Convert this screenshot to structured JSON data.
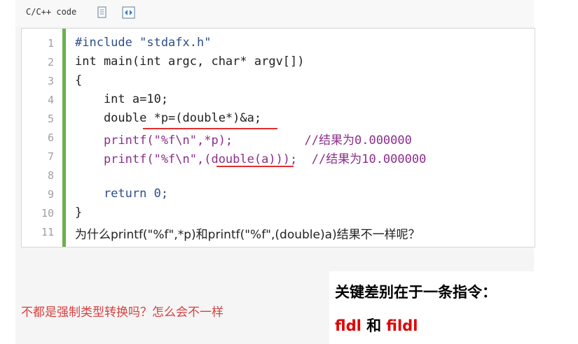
{
  "toolbar": {
    "label": "C/C++ code",
    "icons": [
      "copy-icon",
      "view-source-icon"
    ]
  },
  "code": {
    "line_numbers": [
      "1",
      "2",
      "3",
      "4",
      "5",
      "6",
      "7",
      "8",
      "9",
      "10",
      "11"
    ],
    "lines": [
      "#include \"stdafx.h\"",
      "int main(int argc, char* argv[])",
      "{",
      "    int a=10;",
      "    double *p=(double*)&a;",
      "    printf(\"%f\\n\",*p);          //结果为0.000000",
      "    printf(\"%f\\n\",(double(a)));  //结果为10.000000",
      "",
      "    return 0;",
      "}",
      "为什么printf(\"%f\",*p)和printf(\"%f\",(double)a)结果不一样呢？"
    ]
  },
  "annotations": {
    "bottom_left": "不都是强制类型转换吗？怎么会不一样",
    "key_title": "关键差别在于一条指令：",
    "key_inst_1": "fldl",
    "key_and": " 和 ",
    "key_inst_2": "fildl"
  },
  "colors": {
    "gutter_bar": "#6ab04c",
    "underline": "#e03030",
    "annotation_red": "#d84040",
    "instruction_red": "#e00000"
  }
}
